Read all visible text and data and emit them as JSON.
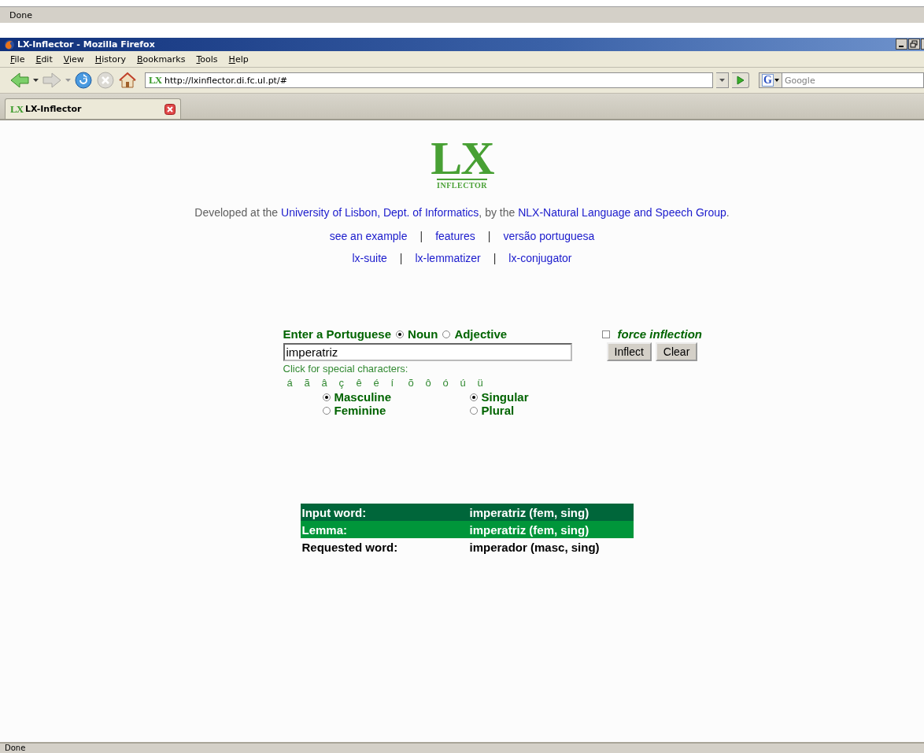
{
  "outer_status": {
    "text": "Done"
  },
  "window": {
    "title": "LX-Inflector - Mozilla Firefox"
  },
  "menu": [
    "File",
    "Edit",
    "View",
    "History",
    "Bookmarks",
    "Tools",
    "Help"
  ],
  "address_bar": {
    "site_icon": "LX",
    "url": "http://lxinflector.di.fc.ul.pt/#"
  },
  "search": {
    "engine_icon": "G",
    "placeholder": "Google"
  },
  "tabs": [
    {
      "icon": "LX",
      "label": "LX-Inflector",
      "selected": true
    }
  ],
  "page": {
    "logo": {
      "title": "LX",
      "subtitle": "INFLECTOR"
    },
    "intro": [
      {
        "kind": "text",
        "text": "Developed at the "
      },
      {
        "kind": "link",
        "text": "University of Lisbon, Dept. of Informatics"
      },
      {
        "kind": "text",
        "text": ", by the "
      },
      {
        "kind": "link",
        "text": "NLX-Natural Language and Speech Group"
      },
      {
        "kind": "text",
        "text": "."
      }
    ],
    "link_rows": [
      [
        {
          "kind": "link",
          "text": "see an example"
        },
        {
          "kind": "separator",
          "text": "|"
        },
        {
          "kind": "link",
          "text": "features"
        },
        {
          "kind": "separator",
          "text": "|"
        },
        {
          "kind": "link",
          "text": "versão portuguesa"
        }
      ],
      [
        {
          "kind": "link",
          "text": "lx-suite"
        },
        {
          "kind": "separator",
          "text": "|"
        },
        {
          "kind": "link",
          "text": "lx-lemmatizer"
        },
        {
          "kind": "separator",
          "text": "|"
        },
        {
          "kind": "link",
          "text": "lx-conjugator"
        }
      ]
    ],
    "form": {
      "prompt": "Enter a Portuguese",
      "pos": [
        {
          "label": "Noun",
          "selected": true
        },
        {
          "label": "Adjective",
          "selected": false
        }
      ],
      "force_inflection": {
        "label": "force inflection",
        "checked": false
      },
      "word": {
        "value": "imperatriz"
      },
      "buttons": [
        "Inflect",
        "Clear"
      ],
      "special_label": "Click for special characters:",
      "special_chars": [
        "á",
        "ã",
        "â",
        "ç",
        "ê",
        "é",
        "í",
        "õ",
        "ô",
        "ó",
        "ú",
        "ü"
      ],
      "gender": [
        {
          "label": "Masculine",
          "selected": true
        },
        {
          "label": "Feminine",
          "selected": false
        }
      ],
      "number": [
        {
          "label": "Singular",
          "selected": true
        },
        {
          "label": "Plural",
          "selected": false
        }
      ]
    },
    "results": [
      {
        "kind": "input",
        "label": "Input word:",
        "value": "imperatriz (fem, sing)"
      },
      {
        "kind": "lemma",
        "label": "Lemma:",
        "value": "imperatriz (fem, sing)"
      },
      {
        "kind": "requested",
        "label": "Requested word:",
        "value": "imperador (masc, sing)"
      }
    ]
  },
  "status_bar": {
    "text": "Done"
  }
}
